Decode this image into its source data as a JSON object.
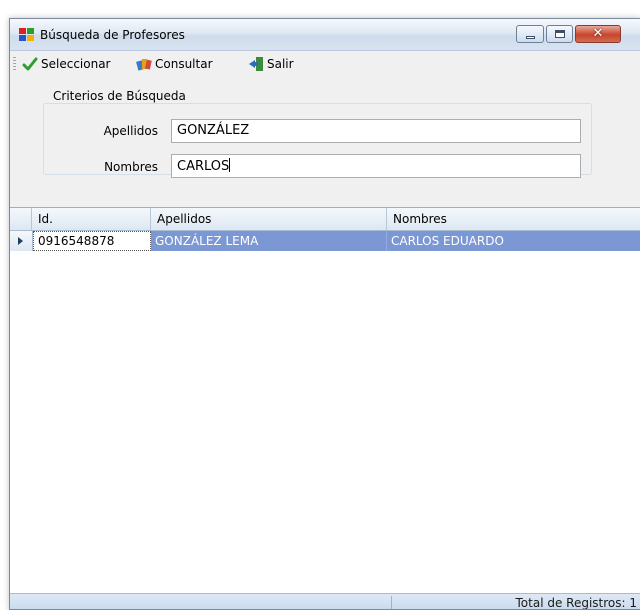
{
  "window": {
    "title": "Búsqueda de Profesores"
  },
  "toolbar": {
    "select_label": "Seleccionar",
    "consult_label": "Consultar",
    "exit_label": "Salir"
  },
  "criteria": {
    "legend": "Criterios de Búsqueda",
    "apellidos_label": "Apellidos",
    "apellidos_value": "GONZÁLEZ",
    "nombres_label": "Nombres",
    "nombres_value": "CARLOS"
  },
  "grid": {
    "columns": [
      "Id.",
      "Apellidos",
      "Nombres"
    ],
    "rows": [
      {
        "id": "0916548878",
        "apellidos": "GONZÁLEZ LEMA",
        "nombres": "CARLOS EDUARDO"
      }
    ]
  },
  "status": {
    "total": "Total de Registros: 1"
  },
  "colors": {
    "selection": "#7b97d4",
    "titlebar": "#dfe8f3",
    "background": "#f0f0f0"
  }
}
